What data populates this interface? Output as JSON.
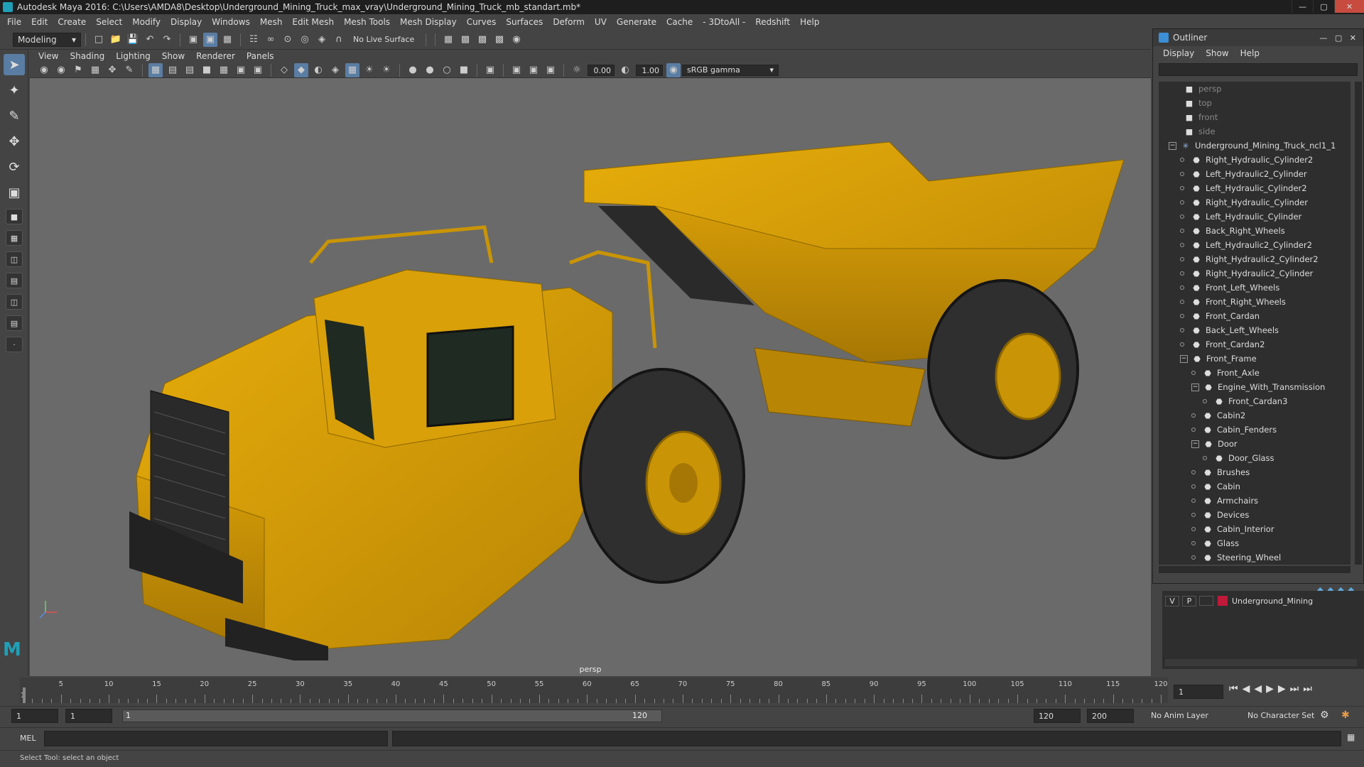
{
  "window": {
    "title": "Autodesk Maya 2016: C:\\Users\\AMDA8\\Desktop\\Underground_Mining_Truck_max_vray\\Underground_Mining_Truck_mb_standart.mb*"
  },
  "menu": [
    "File",
    "Edit",
    "Create",
    "Select",
    "Modify",
    "Display",
    "Windows",
    "Mesh",
    "Edit Mesh",
    "Mesh Tools",
    "Mesh Display",
    "Curves",
    "Surfaces",
    "Deform",
    "UV",
    "Generate",
    "Cache",
    "- 3DtoAll -",
    "Redshift",
    "Help"
  ],
  "shelf": {
    "mode": "Modeling",
    "live_surface": "No Live Surface"
  },
  "viewport": {
    "menu": [
      "View",
      "Shading",
      "Lighting",
      "Show",
      "Renderer",
      "Panels"
    ],
    "exposure": "0.00",
    "gamma": "1.00",
    "color_space": "sRGB gamma",
    "camera": "persp"
  },
  "outliner": {
    "title": "Outliner",
    "menu": [
      "Display",
      "Show",
      "Help"
    ],
    "items": [
      {
        "label": "persp",
        "depth": 0,
        "kind": "camera",
        "dim": true
      },
      {
        "label": "top",
        "depth": 0,
        "kind": "camera",
        "dim": true
      },
      {
        "label": "front",
        "depth": 0,
        "kind": "camera",
        "dim": true
      },
      {
        "label": "side",
        "depth": 0,
        "kind": "camera",
        "dim": true
      },
      {
        "label": "Underground_Mining_Truck_ncl1_1",
        "depth": 0,
        "kind": "root",
        "expanded": true
      },
      {
        "label": "Right_Hydraulic_Cylinder2",
        "depth": 1,
        "kind": "mesh"
      },
      {
        "label": "Left_Hydraulic2_Cylinder",
        "depth": 1,
        "kind": "mesh"
      },
      {
        "label": "Left_Hydraulic_Cylinder2",
        "depth": 1,
        "kind": "mesh"
      },
      {
        "label": "Right_Hydraulic_Cylinder",
        "depth": 1,
        "kind": "mesh"
      },
      {
        "label": "Left_Hydraulic_Cylinder",
        "depth": 1,
        "kind": "mesh"
      },
      {
        "label": "Back_Right_Wheels",
        "depth": 1,
        "kind": "mesh"
      },
      {
        "label": "Left_Hydraulic2_Cylinder2",
        "depth": 1,
        "kind": "mesh"
      },
      {
        "label": "Right_Hydraulic2_Cylinder2",
        "depth": 1,
        "kind": "mesh"
      },
      {
        "label": "Right_Hydraulic2_Cylinder",
        "depth": 1,
        "kind": "mesh"
      },
      {
        "label": "Front_Left_Wheels",
        "depth": 1,
        "kind": "mesh"
      },
      {
        "label": "Front_Right_Wheels",
        "depth": 1,
        "kind": "mesh"
      },
      {
        "label": "Front_Cardan",
        "depth": 1,
        "kind": "mesh"
      },
      {
        "label": "Back_Left_Wheels",
        "depth": 1,
        "kind": "mesh"
      },
      {
        "label": "Front_Cardan2",
        "depth": 1,
        "kind": "mesh"
      },
      {
        "label": "Front_Frame",
        "depth": 1,
        "kind": "mesh",
        "expanded": true
      },
      {
        "label": "Front_Axle",
        "depth": 2,
        "kind": "mesh"
      },
      {
        "label": "Engine_With_Transmission",
        "depth": 2,
        "kind": "mesh",
        "expanded": true
      },
      {
        "label": "Front_Cardan3",
        "depth": 3,
        "kind": "mesh"
      },
      {
        "label": "Cabin2",
        "depth": 2,
        "kind": "mesh"
      },
      {
        "label": "Cabin_Fenders",
        "depth": 2,
        "kind": "mesh"
      },
      {
        "label": "Door",
        "depth": 2,
        "kind": "mesh",
        "expanded": true
      },
      {
        "label": "Door_Glass",
        "depth": 3,
        "kind": "mesh"
      },
      {
        "label": "Brushes",
        "depth": 2,
        "kind": "mesh"
      },
      {
        "label": "Cabin",
        "depth": 2,
        "kind": "mesh"
      },
      {
        "label": "Armchairs",
        "depth": 2,
        "kind": "mesh"
      },
      {
        "label": "Devices",
        "depth": 2,
        "kind": "mesh"
      },
      {
        "label": "Cabin_Interior",
        "depth": 2,
        "kind": "mesh"
      },
      {
        "label": "Glass",
        "depth": 2,
        "kind": "mesh"
      },
      {
        "label": "Steering_Wheel",
        "depth": 2,
        "kind": "mesh"
      }
    ]
  },
  "layer": {
    "visible": "V",
    "playback": "P",
    "color": "#c0193a",
    "name": "Underground_Mining"
  },
  "timeline": {
    "labels": [
      "1",
      "5",
      "10",
      "15",
      "20",
      "25",
      "30",
      "35",
      "40",
      "45",
      "50",
      "55",
      "60",
      "65",
      "70",
      "75",
      "80",
      "85",
      "90",
      "95",
      "100",
      "105",
      "110",
      "115",
      "120"
    ],
    "current_frame": "1"
  },
  "range": {
    "start": "1",
    "start2": "1",
    "slider_start": "1",
    "slider_end": "120",
    "end": "120",
    "end2": "200",
    "anim_layer": "No Anim Layer",
    "char_set": "No Character Set"
  },
  "cmd": {
    "label": "MEL"
  },
  "help": {
    "text": "Select Tool: select an object"
  }
}
